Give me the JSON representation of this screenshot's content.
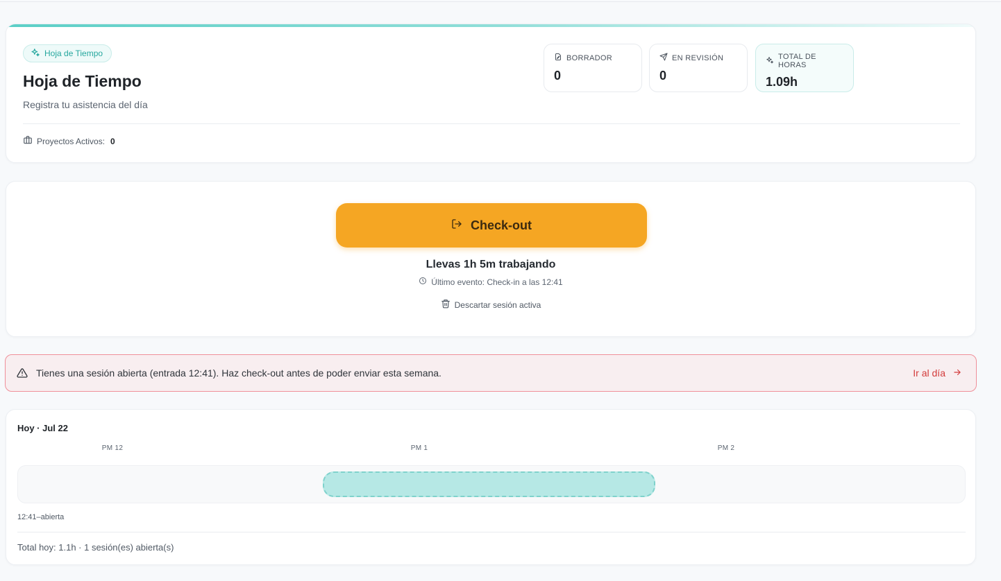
{
  "header": {
    "chip_label": "Hoja de Tiempo",
    "title": "Hoja de Tiempo",
    "subtitle": "Registra tu asistencia del día",
    "projects_label": "Proyectos Activos:",
    "projects_value": "0",
    "accent_color": "#5ccfc7"
  },
  "stats": [
    {
      "label": "BORRADOR",
      "value": "0",
      "icon": "draft-icon"
    },
    {
      "label": "EN REVISIÓN",
      "value": "0",
      "icon": "send-icon"
    },
    {
      "label": "TOTAL DE HORAS",
      "value": "1.09h",
      "icon": "sparkles-icon"
    }
  ],
  "checkout": {
    "button_label": "Check-out",
    "button_color": "#f5a623",
    "working_text": "Llevas 1h 5m trabajando",
    "last_event": "Último evento: Check-in a las 12:41",
    "discard_label": "Descartar sesión activa"
  },
  "alert": {
    "text": "Tienes una sesión abierta (entrada 12:41). Haz check-out antes de poder enviar esta semana.",
    "link_label": "Ir al día",
    "border_color": "#ef8f99",
    "link_color": "#d33a3a"
  },
  "timeline": {
    "title": "Hoy · Jul 22",
    "ticks": [
      "PM 12",
      "PM 1",
      "PM 2"
    ],
    "session": {
      "start": "12:41",
      "end": "13:46"
    },
    "session_label": "12:41–abierta",
    "total_text": "Total hoy: 1.1h · 1 sesión(es) abierta(s)",
    "session_color": "#b6e8e5"
  }
}
